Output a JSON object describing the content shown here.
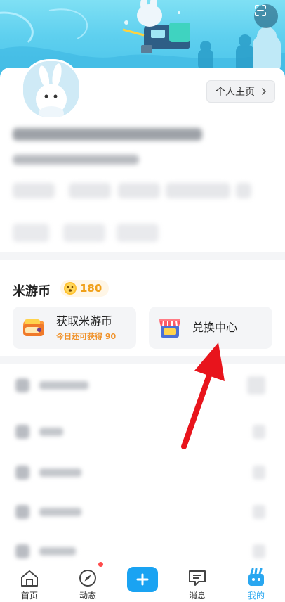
{
  "header": {
    "scan_icon": "scan-icon",
    "profile_button_label": "个人主页",
    "profile_button_icon": "chevron-right-icon"
  },
  "coins": {
    "title": "米游币",
    "balance": "180",
    "balance_icon": "coin-face-icon",
    "earn": {
      "title": "获取米游币",
      "subtitle": "今日还可获得 90",
      "icon": "wallet-icon"
    },
    "exchange": {
      "title": "兑换中心",
      "icon": "shop-icon"
    }
  },
  "tabbar": {
    "items": [
      {
        "label": "首页",
        "icon": "home-icon"
      },
      {
        "label": "动态",
        "icon": "compass-icon"
      },
      {
        "label": "",
        "icon": "plus-icon"
      },
      {
        "label": "消息",
        "icon": "chat-icon"
      },
      {
        "label": "我的",
        "icon": "profile-tab-icon",
        "active": true
      }
    ]
  },
  "colors": {
    "accent": "#1aa3f2",
    "coin_orange": "#f0a019",
    "annotation_arrow": "#e8141c"
  }
}
